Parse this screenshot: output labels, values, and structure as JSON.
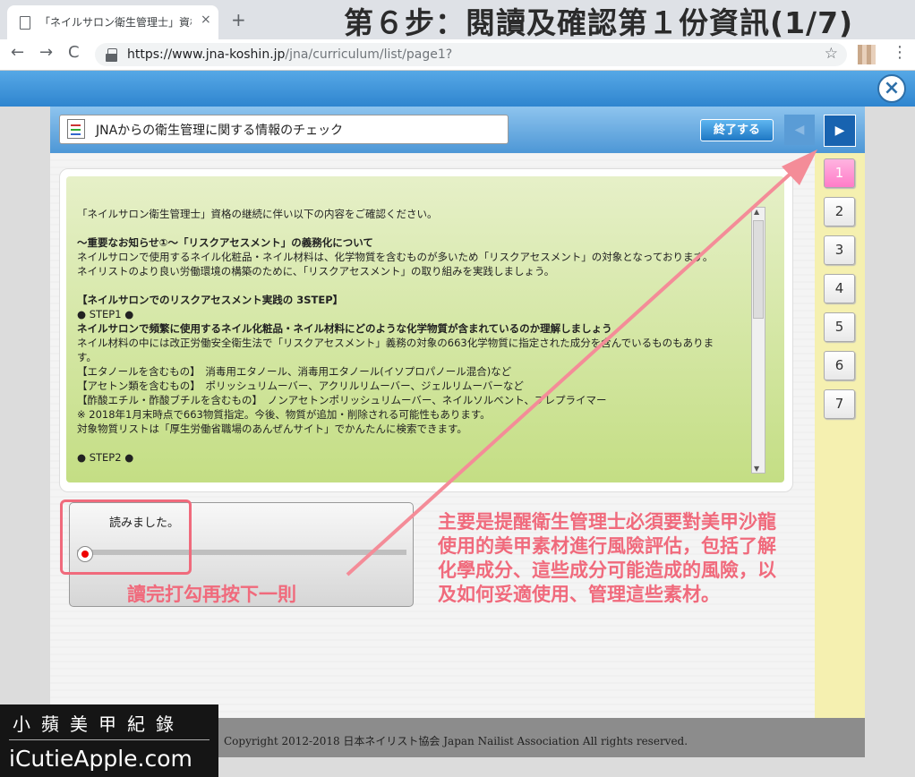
{
  "browser": {
    "tab_title": "「ネイルサロン衛生管理士」資格",
    "tab_close": "×",
    "new_tab": "+",
    "url_host": "https://www.jna-koshin.jp",
    "url_path": "/jna/curriculum/list/page1?",
    "back": "←",
    "forward": "→",
    "reload": "C",
    "star": "☆",
    "menu": "⋮"
  },
  "overlay_title": "第６步：閱讀及確認第１份資訊(1/7)",
  "app": {
    "close": "×",
    "title": "JNAからの衛生管理に関する情報のチェック",
    "end_button": "終了する",
    "prev": "◀",
    "next": "▶",
    "pages": [
      "1",
      "2",
      "3",
      "4",
      "5",
      "6",
      "7"
    ],
    "active_page": "1"
  },
  "content_lines": [
    {
      "text": "「ネイルサロン衛生管理士」資格の継続に伴い以下の内容をご確認ください。",
      "bold": false
    },
    {
      "text": "",
      "bold": false
    },
    {
      "text": "～重要なお知らせ①～「リスクアセスメント」の義務化について",
      "bold": true
    },
    {
      "text": "ネイルサロンで使用するネイル化粧品・ネイル材料は、化学物質を含むものが多いため「リスクアセスメント」の対象となっております。",
      "bold": false
    },
    {
      "text": "ネイリストのより良い労働環境の構築のために、「リスクアセスメント」の取り組みを実践しましょう。",
      "bold": false
    },
    {
      "text": "",
      "bold": false
    },
    {
      "text": "【ネイルサロンでのリスクアセスメント実践の 3STEP】",
      "bold": true
    },
    {
      "text": "● STEP1 ●",
      "bold": false
    },
    {
      "text": "ネイルサロンで頻繁に使用するネイル化粧品・ネイル材料にどのような化学物質が含まれているのか理解しましょう",
      "bold": true
    },
    {
      "text": "ネイル材料の中には改正労働安全衛生法で「リスクアセスメント」義務の対象の663化学物質に指定された成分を含んでいるものもありま",
      "bold": false
    },
    {
      "text": "す。",
      "bold": false
    },
    {
      "text": "【エタノールを含むもの】　消毒用エタノール、消毒用エタノール(イソプロパノール混合)など",
      "bold": false
    },
    {
      "text": "【アセトン類を含むもの】　ポリッシュリムーバー、アクリルリムーバー、ジェルリムーバーなど",
      "bold": false
    },
    {
      "text": "【酢酸エチル・酢酸ブチルを含むもの】　ノンアセトンポリッシュリムーバー、ネイルソルベント、プレプライマー",
      "bold": false
    },
    {
      "text": "※ 2018年1月末時点で663物質指定。今後、物質が追加・削除される可能性もあります。",
      "bold": false
    },
    {
      "text": "対象物質リストは「厚生労働省職場のあんぜんサイト」でかんたんに検索できます。",
      "bold": false
    },
    {
      "text": "",
      "bold": false
    },
    {
      "text": "● STEP2 ●",
      "bold": false
    }
  ],
  "read_label": "読みました。",
  "annotation_short": "讀完打勾再按下一則",
  "annotation_long": [
    "主要是提醒衛生管理士必須要對美甲沙龍",
    "使用的美甲素材進行風險評估，包括了解",
    "化學成分、這些成分可能造成的風險，以",
    "及如何妥適使用、管理這些素材。"
  ],
  "footer": "Copyright 2012-2018 日本ネイリスト協会 Japan Nailist Association All rights reserved.",
  "logo": {
    "zh": "小蘋美甲紀錄",
    "en": "iCutieApple.com"
  },
  "colors": {
    "annotation": "#f06a7c",
    "header_blue": "#2f85cf",
    "active_page": "#ff7cc8",
    "sidebar": "#f5f0b0"
  }
}
